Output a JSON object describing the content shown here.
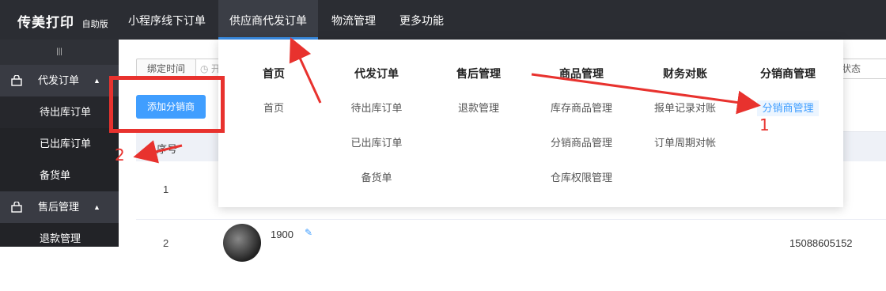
{
  "brand": {
    "name": "传美打印",
    "edition": "自助版"
  },
  "nav": [
    {
      "label": "小程序线下订单",
      "active": false
    },
    {
      "label": "供应商代发订单",
      "active": true
    },
    {
      "label": "物流管理",
      "active": false
    },
    {
      "label": "更多功能",
      "active": false
    }
  ],
  "sidebar": {
    "toggle_icon": "list-icon",
    "groups": [
      {
        "label": "代发订单",
        "icon": "bag-icon",
        "items": [
          "待出库订单",
          "已出库订单",
          "备货单"
        ]
      },
      {
        "label": "售后管理",
        "icon": "bag-icon",
        "items": [
          "退款管理"
        ]
      }
    ]
  },
  "filters": {
    "time_label": "绑定时间",
    "time_placeholder": "开",
    "status_label": "状态"
  },
  "add_button": "添加分销商",
  "table": {
    "header_index": "序号",
    "rows": [
      {
        "index": "1",
        "name": "",
        "phone": ""
      },
      {
        "index": "2",
        "name": "1900",
        "phone": "15088605152"
      }
    ]
  },
  "dropdown": {
    "columns": [
      {
        "title": "首页",
        "links": [
          "首页"
        ]
      },
      {
        "title": "代发订单",
        "links": [
          "待出库订单",
          "已出库订单",
          "备货单"
        ]
      },
      {
        "title": "售后管理",
        "links": [
          "退款管理"
        ]
      },
      {
        "title": "商品管理",
        "links": [
          "库存商品管理",
          "分销商品管理",
          "仓库权限管理"
        ]
      },
      {
        "title": "财务对账",
        "links": [
          "报单记录对账",
          "订单周期对帐"
        ]
      },
      {
        "title": "分销商管理",
        "links": [
          "分销商管理"
        ]
      }
    ]
  },
  "annotations": {
    "label_1": "1",
    "label_2": "2",
    "color": "#e8322e"
  }
}
